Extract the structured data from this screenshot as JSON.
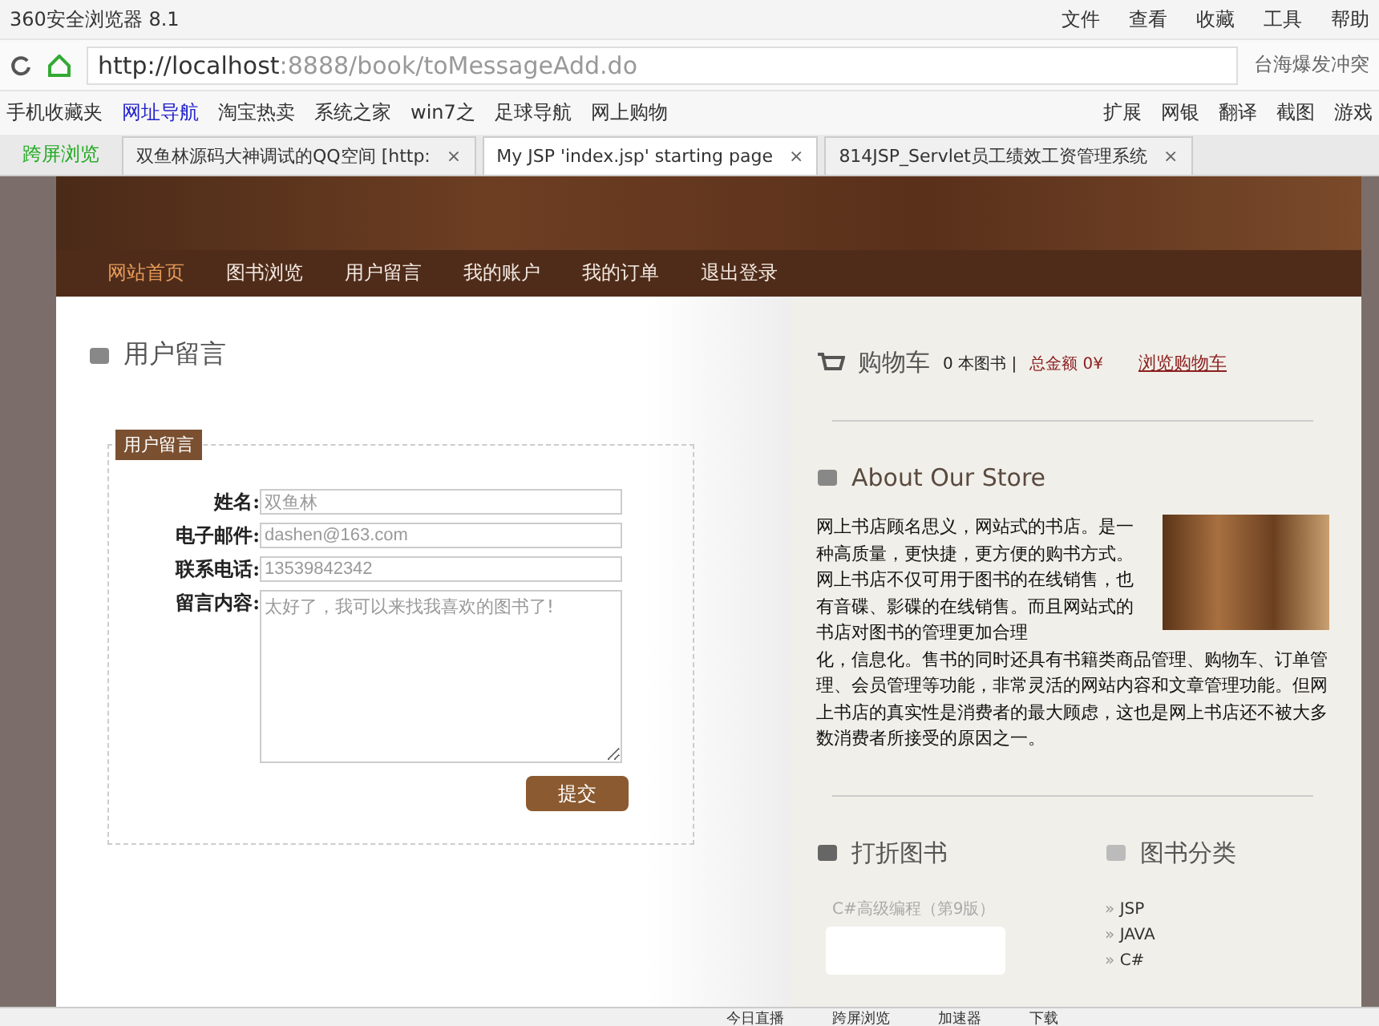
{
  "browser": {
    "title": "360安全浏览器 8.1",
    "menu": [
      "文件",
      "查看",
      "收藏",
      "工具",
      "帮助"
    ],
    "url_host": "http://localhost",
    "url_rest": ":8888/book/toMessageAdd.do",
    "search_hint": "台海爆发冲突",
    "bookmarks": [
      "手机收藏夹",
      "网址导航",
      "淘宝热卖",
      "系统之家",
      "win7之",
      "足球导航",
      "网上购物"
    ],
    "tools": [
      "扩展",
      "网银",
      "翻译",
      "截图",
      "游戏"
    ],
    "cross_screen": "跨屏浏览",
    "tab_close": "×",
    "tabs": [
      {
        "label": "双鱼林源码大神调试的QQ空间 [http:",
        "selected": false
      },
      {
        "label": "My JSP 'index.jsp' starting page",
        "selected": true
      },
      {
        "label": "814JSP_Servlet员工绩效工资管理系统",
        "selected": false
      }
    ]
  },
  "nav": [
    {
      "label": "网站首页",
      "selected": true
    },
    {
      "label": "图书浏览",
      "selected": false
    },
    {
      "label": "用户留言",
      "selected": false
    },
    {
      "label": "我的账户",
      "selected": false
    },
    {
      "label": "我的订单",
      "selected": false
    },
    {
      "label": "退出登录",
      "selected": false
    }
  ],
  "page_title": "用户留言",
  "form": {
    "legend": "用户留言",
    "fields": [
      {
        "label": "姓名:",
        "value": "双鱼林",
        "kind": "input"
      },
      {
        "label": "电子邮件:",
        "value": "dashen@163.com",
        "kind": "input"
      },
      {
        "label": "联系电话:",
        "value": "13539842342",
        "kind": "input"
      },
      {
        "label": "留言内容:",
        "value": "太好了，我可以来找我喜欢的图书了!",
        "kind": "textarea"
      }
    ],
    "submit": "提交"
  },
  "cart": {
    "title": "购物车",
    "count": "0 本图书 |",
    "total": "总金额 0¥",
    "link": "浏览购物车"
  },
  "about": {
    "title": "About Our Store",
    "text": [
      "网上书店顾名思义，网站式的书店。是一种高质量，更快捷，更方便的购书方式。网上书店不仅可用于图书的在线销售，也有音碟、影碟的在线销售。而且网站式的书店对图书的管理更加合理",
      "化，信息化。售书的同时还具有书籍类商品管理、购物车、订单管理、会员管理等功能，非常灵活的网站内容和文章管理功能。但网上书店的真实性是消费者的最大顾虑，这也是网上书店还不被大多数消费者所接受的原因之一。"
    ]
  },
  "discount": {
    "title": "打折图书",
    "book": "C#高级编程（第9版）"
  },
  "categories": {
    "title": "图书分类",
    "marker": "»",
    "items": [
      "JSP",
      "JAVA",
      "C#"
    ]
  },
  "status_bar": [
    "今日直播",
    "跨屏浏览",
    "加速器",
    "下载"
  ]
}
